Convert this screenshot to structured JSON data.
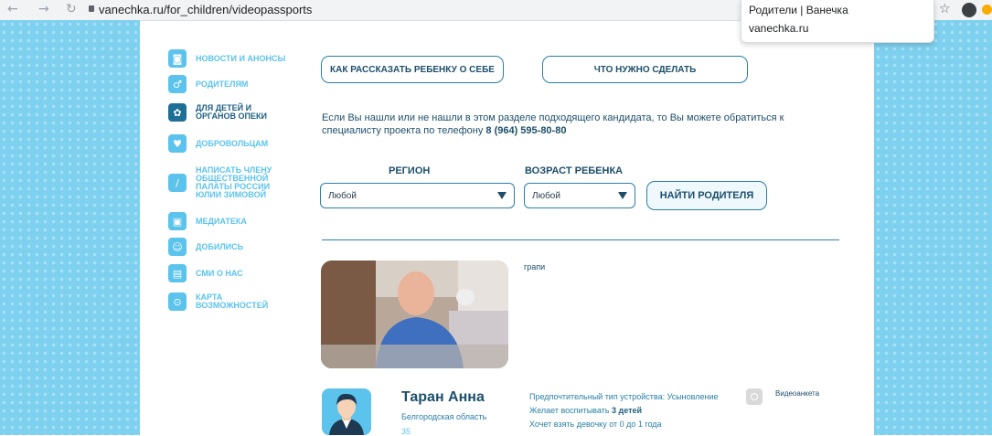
{
  "browser": {
    "url": "vanechka.ru/for_children/videopassports",
    "popup_title": "Родители | Ванечка",
    "popup_domain": "vanechka.ru"
  },
  "menu": [
    {
      "label": "НОВОСТИ И АНОНСЫ",
      "icon": "camera-icon"
    },
    {
      "label": "РОДИТЕЛЯМ",
      "icon": "parents-icon"
    },
    {
      "label": "ДЛЯ ДЕТЕЙ И\nОРГАНОВ ОПЕКИ",
      "icon": "flower-icon",
      "active": true
    },
    {
      "label": "ДОБРОВОЛЬЦАМ",
      "icon": "heart-icon"
    },
    {
      "label": "НАПИСАТЬ ЧЛЕНУ\nОБЩЕСТВЕННОЙ\nПАЛАТЫ РОССИИ\nЮЛИИ ЗИМОВОЙ",
      "icon": "pencil-icon"
    },
    {
      "label": "МЕДИАТЕКА",
      "icon": "media-icon"
    },
    {
      "label": "ДОБИЛИСЬ",
      "icon": "achievement-icon"
    },
    {
      "label": "СМИ О НАС",
      "icon": "book-icon"
    },
    {
      "label": "КАРТА\nВОЗМОЖНОСТЕЙ",
      "icon": "map-pin-icon"
    }
  ],
  "buttons": {
    "tell_child": "КАК РАССКАЗАТЬ РЕБЕНКУ О СЕБЕ",
    "what_to_do": "ЧТО НУЖНО СДЕЛАТЬ",
    "find_parent": "НАЙТИ РОДИТЕЛЯ"
  },
  "info": {
    "text": "Если Вы нашли или не нашли в этом разделе подходящего кандидата, то Вы можете обратиться к специалисту проекта по телефону",
    "phone": "8 (964) 595-80-80"
  },
  "filters": {
    "region_label": "РЕГИОН",
    "region_value": "Любой",
    "age_label": "ВОЗРАСТ РЕБЕНКА",
    "age_value": "Любой"
  },
  "video": {
    "title": "грапи"
  },
  "profile": {
    "name": "Таран Анна",
    "region": "Белгородская область",
    "age": "35",
    "placement_label": "Предпочтительный тип устройства:",
    "placement_value": "Усыновление",
    "wants_prefix": "Желает воспитывать",
    "wants_count": "3 детей",
    "wants_detail": "Хочет взять девочку от 0 до 1 года",
    "video_label": "Видеоанкета"
  },
  "colors": {
    "sidebar_blue": "#7ed0ef",
    "accent": "#5bc3ec",
    "dark_blue": "#1d4f6a"
  }
}
